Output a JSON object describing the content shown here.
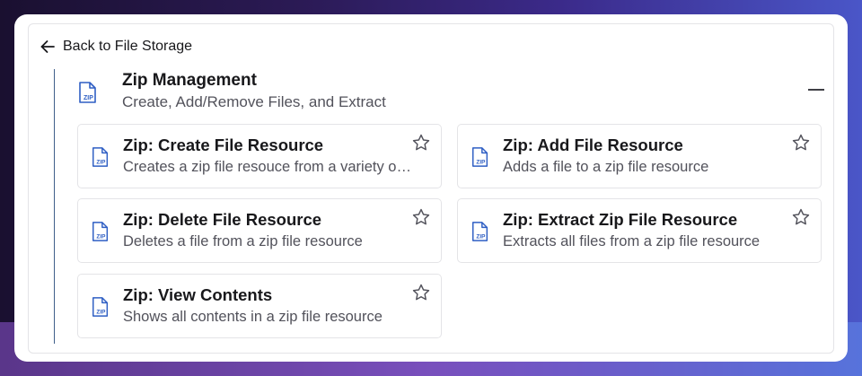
{
  "back": {
    "label": "Back to File Storage"
  },
  "group": {
    "title": "Zip Management",
    "subtitle": "Create, Add/Remove Files, and Extract",
    "icon": "zip-file-icon"
  },
  "cards": [
    {
      "title": "Zip: Create File Resource",
      "description": "Creates a zip file resouce from a variety of sources"
    },
    {
      "title": "Zip: Add File Resource",
      "description": "Adds a file to a zip file resource"
    },
    {
      "title": "Zip: Delete File Resource",
      "description": "Deletes a file from a zip file resource"
    },
    {
      "title": "Zip: Extract Zip File Resource",
      "description": "Extracts all files from a zip file resource"
    },
    {
      "title": "Zip: View Contents",
      "description": "Shows all contents in a zip file resource"
    }
  ],
  "colors": {
    "accent": "#2f5fc4",
    "tree_line": "#3f5f8a",
    "title_text": "#18181b",
    "muted_text": "#52525b",
    "border": "#e4e4e7"
  }
}
